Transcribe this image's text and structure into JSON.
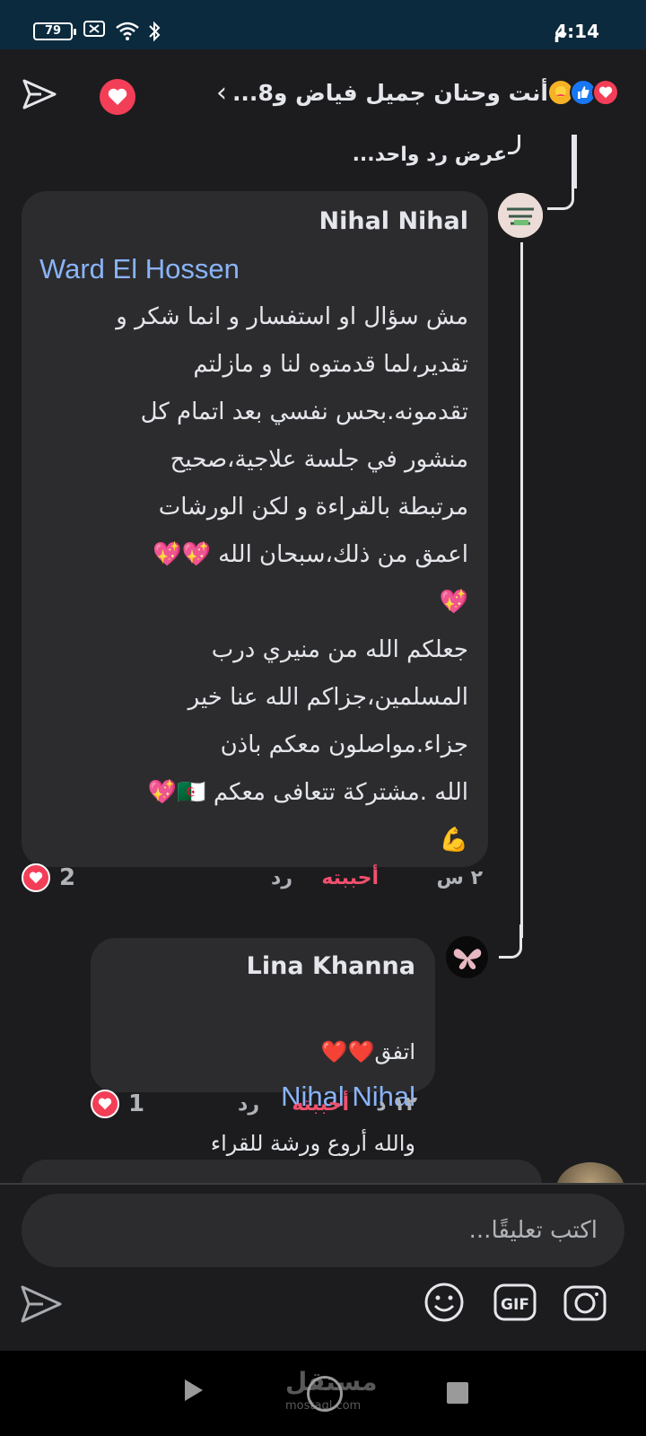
{
  "status_bar": {
    "battery": "79",
    "time": "4:14",
    "ampm": "م"
  },
  "header": {
    "title": "أنت وحنان جميل فياض و8...",
    "reactions": [
      "care",
      "like",
      "love"
    ]
  },
  "thread": {
    "view_replies": "عرض رد واحد..."
  },
  "comments": [
    {
      "author": "Nihal Nihal",
      "mention": "Ward El Hossen",
      "text": "مش سؤال او استفسار و انما شكر و\nتقدير،لما قدمتوه لنا و مازلتم\nتقدمونه.بحس نفسي بعد اتمام كل\nمنشور في جلسة علاجية،صحيح\nمرتبطة بالقراءة و لكن الورشات\nاعمق من ذلك،سبحان الله 💖💖\n💖\nجعلكم الله من منيري درب\nالمسلمين،جزاكم الله عنا خير\nجزاء.مواصلون معكم باذن\nالله .مشتركة تتعافى معكم 🇩🇿💖\n💪",
      "time": "٢ س",
      "like_label": "أحببته",
      "reply_label": "رد",
      "reaction_count": "2"
    },
    {
      "author": "Lina Khanna",
      "mention": "Nihal Nihal",
      "text_line1": "اتفق❤️❤️",
      "text_line2": "والله أروع ورشة للقراء",
      "time": "١٢ د",
      "like_label": "أحببته",
      "reply_label": "رد",
      "reaction_count": "1"
    }
  ],
  "composer": {
    "placeholder": "اكتب تعليقًا..."
  },
  "watermark": {
    "text": "مستقل",
    "sub": "mostaql.com"
  }
}
